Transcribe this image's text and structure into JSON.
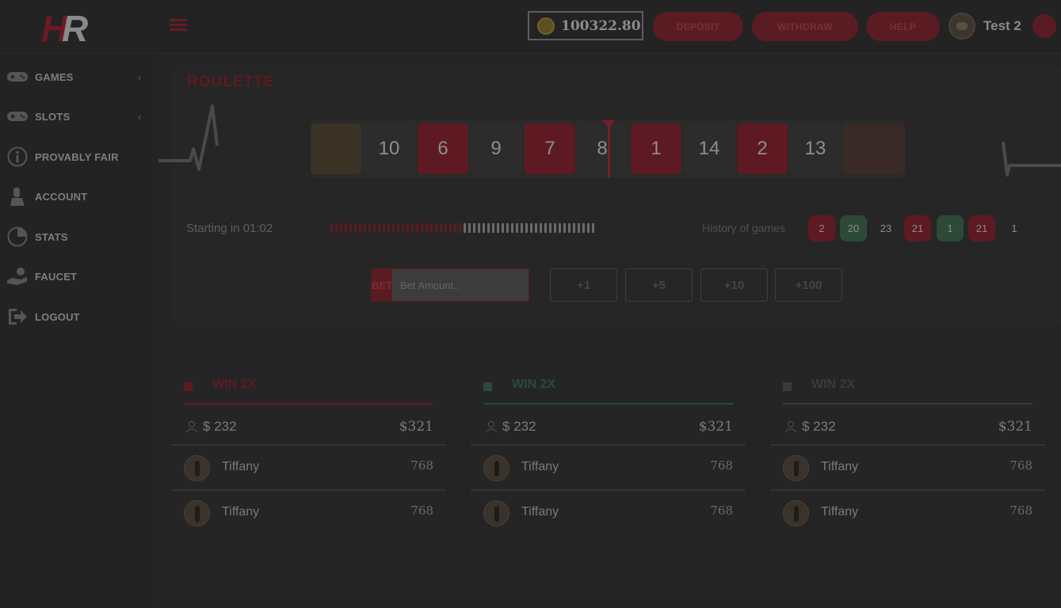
{
  "header": {
    "logo_text": "HR",
    "balance": "100322.80",
    "buttons": {
      "deposit": "DEPOSIT",
      "withdraw": "WITHDRAW",
      "help": "HELP"
    },
    "username": "Test 2"
  },
  "sidebar": {
    "items": [
      {
        "label": "GAMES",
        "icon": "gamepad-icon",
        "has_chevron": true
      },
      {
        "label": "SLOTS",
        "icon": "gamepad-icon",
        "has_chevron": true
      },
      {
        "label": "PROVABLY FAIR",
        "icon": "info-icon",
        "has_chevron": false
      },
      {
        "label": "ACCOUNT",
        "icon": "user-icon",
        "has_chevron": false
      },
      {
        "label": "STATS",
        "icon": "pie-chart-icon",
        "has_chevron": false
      },
      {
        "label": "FAUCET",
        "icon": "hand-coin-icon",
        "has_chevron": false
      },
      {
        "label": "LOGOUT",
        "icon": "logout-icon",
        "has_chevron": false
      }
    ],
    "chevron": "‹"
  },
  "game": {
    "title": "ROULETTE",
    "wheel_tiles": [
      {
        "value": "",
        "color": "fade-l"
      },
      {
        "value": "10",
        "color": "black"
      },
      {
        "value": "6",
        "color": "red"
      },
      {
        "value": "9",
        "color": "black"
      },
      {
        "value": "7",
        "color": "red"
      },
      {
        "value": "8",
        "color": "black"
      },
      {
        "value": "1",
        "color": "red"
      },
      {
        "value": "14",
        "color": "black"
      },
      {
        "value": "2",
        "color": "red"
      },
      {
        "value": "13",
        "color": "black"
      },
      {
        "value": "",
        "color": "fade-r"
      }
    ],
    "countdown_label": "Starting in 01:02",
    "countdown_progress": 0.5,
    "history_label": "History of games",
    "history": [
      {
        "value": "2",
        "color": "red"
      },
      {
        "value": "20",
        "color": "green"
      },
      {
        "value": "23",
        "color": "black"
      },
      {
        "value": "21",
        "color": "red"
      },
      {
        "value": "1",
        "color": "green"
      },
      {
        "value": "21",
        "color": "red"
      },
      {
        "value": "1",
        "color": "black"
      }
    ],
    "bet_button": "BET",
    "bet_placeholder": "Bet Amount..",
    "add_buttons": [
      "+1",
      "+5",
      "+10",
      "+100"
    ]
  },
  "columns": [
    {
      "title": "WIN 2X",
      "accent": "#5e1a22",
      "players": "$ 232",
      "total": "$321",
      "rows": [
        {
          "name": "Tiffany",
          "value": "768"
        },
        {
          "name": "Tiffany",
          "value": "768"
        }
      ]
    },
    {
      "title": "WIN 2X",
      "accent": "#2d4a38",
      "players": "$ 232",
      "total": "$321",
      "rows": [
        {
          "name": "Tiffany",
          "value": "768"
        },
        {
          "name": "Tiffany",
          "value": "768"
        }
      ]
    },
    {
      "title": "WIN 2X",
      "accent": "#3a3a3a",
      "players": "$ 232",
      "total": "$321",
      "rows": [
        {
          "name": "Tiffany",
          "value": "768"
        },
        {
          "name": "Tiffany",
          "value": "768"
        }
      ]
    }
  ]
}
